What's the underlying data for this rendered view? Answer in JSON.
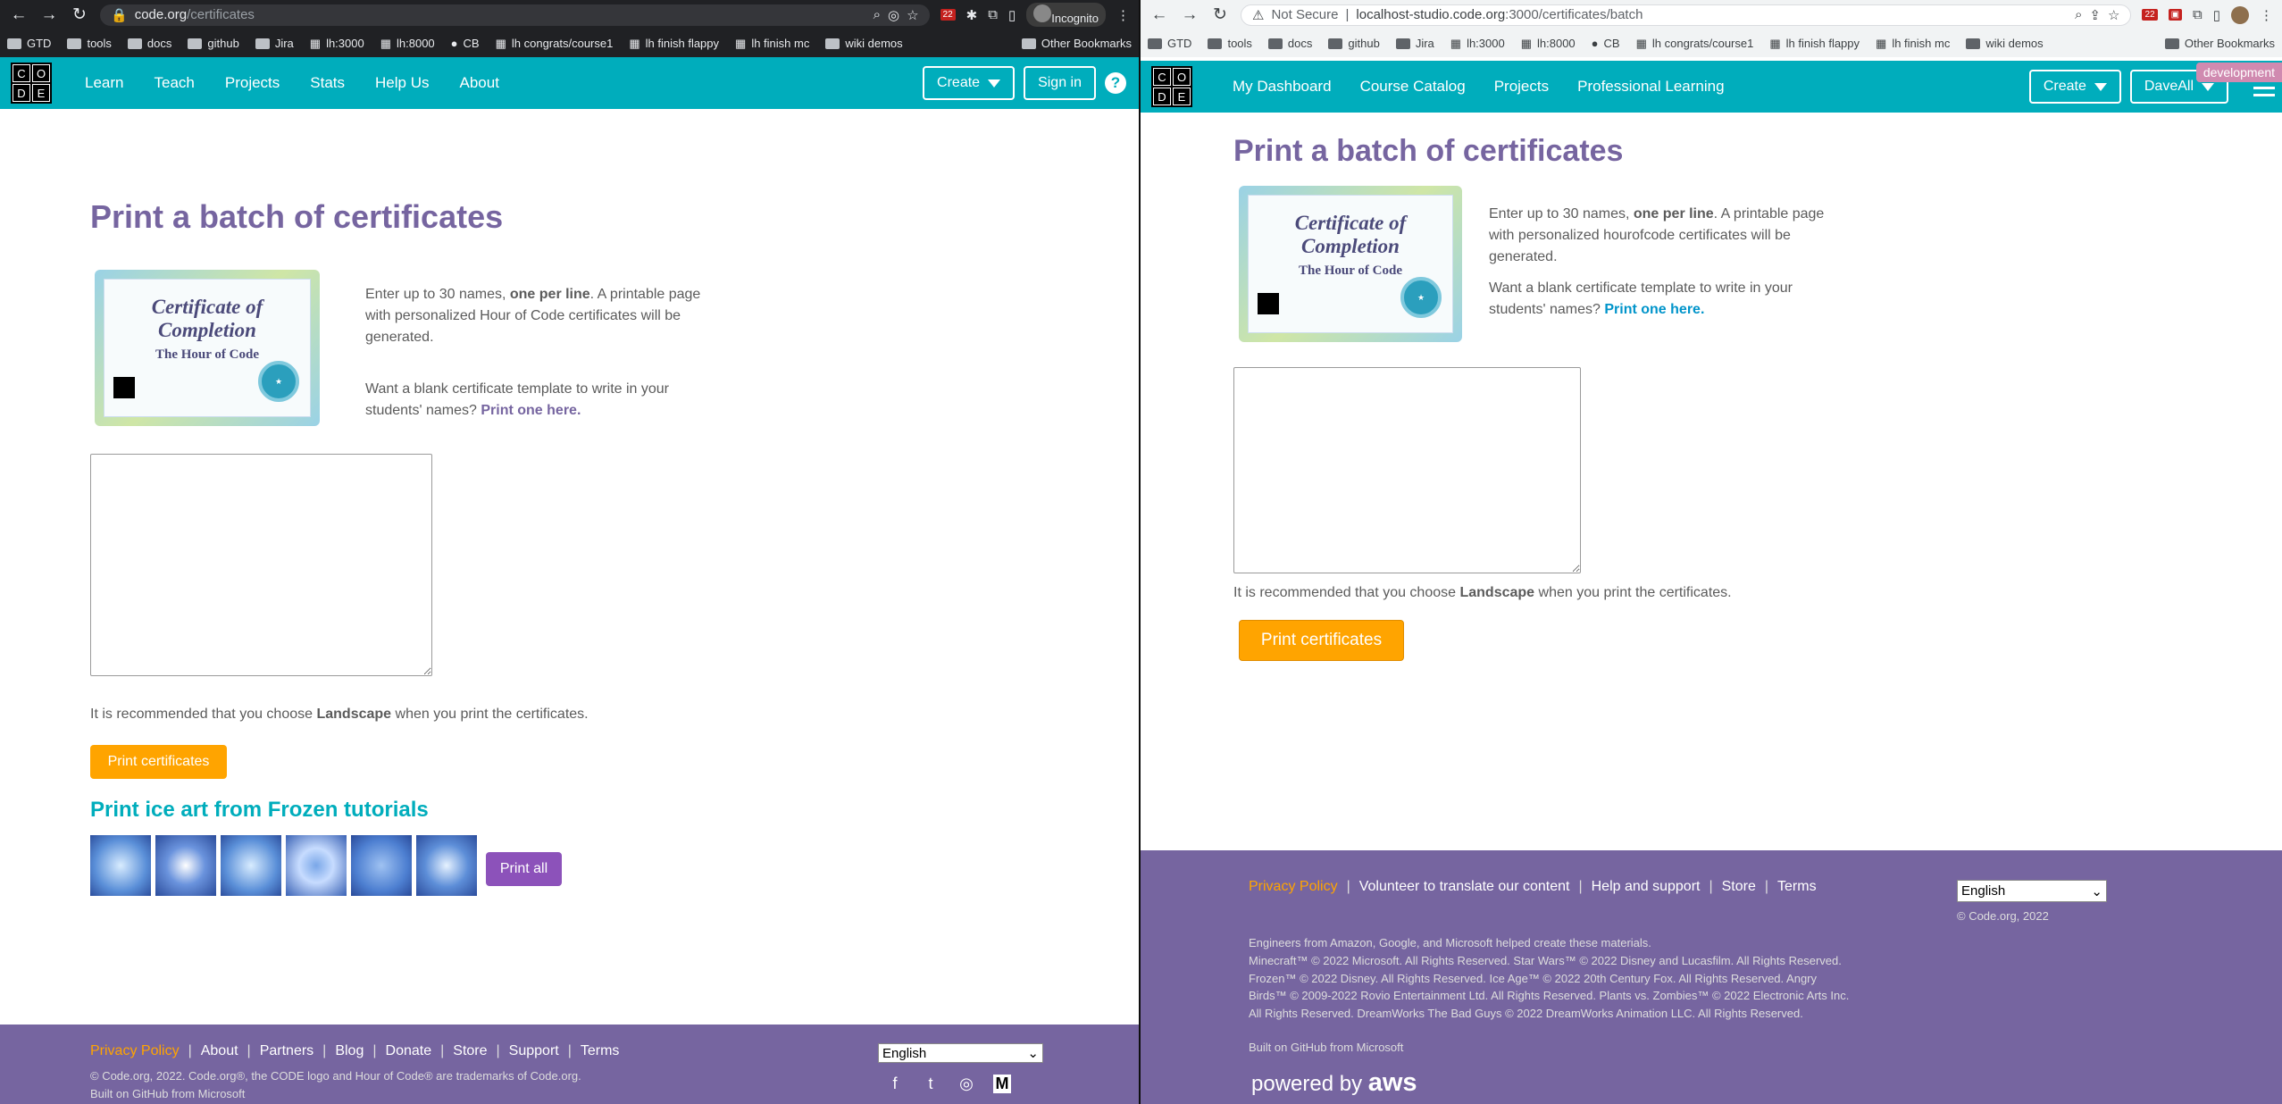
{
  "left": {
    "tab": {
      "url_host": "code.org",
      "url_path": "/certificates",
      "incognito": "Incognito"
    },
    "bookmarks": [
      "GTD",
      "tools",
      "docs",
      "github",
      "Jira",
      "lh:3000",
      "lh:8000",
      "CB",
      "lh congrats/course1",
      "lh finish flappy",
      "lh finish mc",
      "wiki demos"
    ],
    "other_bookmarks": "Other Bookmarks",
    "nav": [
      "Learn",
      "Teach",
      "Projects",
      "Stats",
      "Help Us",
      "About"
    ],
    "create_label": "Create",
    "signin_label": "Sign in",
    "help_label": "?",
    "title": "Print a batch of certificates",
    "cert_title": "Certificate of Completion",
    "cert_sub": "The Hour of Code",
    "intro_pre": "Enter up to 30 names, ",
    "intro_bold": "one per line",
    "intro_post": ". A printable page with personalized Hour of Code certificates will be generated.",
    "blank_pre": "Want a blank certificate template to write in your students' names? ",
    "blank_link": "Print one here.",
    "rec_pre": "It is recommended that you choose ",
    "rec_bold": "Landscape",
    "rec_post": " when you print the certificates.",
    "print_button": "Print certificates",
    "ice_title": "Print ice art from Frozen tutorials",
    "print_all": "Print all",
    "footer_links": [
      "Privacy Policy",
      "About",
      "Partners",
      "Blog",
      "Donate",
      "Store",
      "Support",
      "Terms"
    ],
    "language": "English",
    "copyright": "© Code.org, 2022. Code.org®, the CODE logo and Hour of Code® are trademarks of Code.org.",
    "built": "Built on GitHub from Microsoft"
  },
  "right": {
    "tab": {
      "not_secure": "Not Secure",
      "url_host": "localhost-studio.code.org",
      "url_path": ":3000/certificates/batch"
    },
    "bookmarks": [
      "GTD",
      "tools",
      "docs",
      "github",
      "Jira",
      "lh:3000",
      "lh:8000",
      "CB",
      "lh congrats/course1",
      "lh finish flappy",
      "lh finish mc",
      "wiki demos"
    ],
    "other_bookmarks": "Other Bookmarks",
    "dev_tag": "development",
    "nav": [
      "My Dashboard",
      "Course Catalog",
      "Projects",
      "Professional Learning"
    ],
    "create_label": "Create",
    "user_label": "DaveAll",
    "title": "Print a batch of certificates",
    "cert_title": "Certificate of Completion",
    "cert_sub": "The Hour of Code",
    "intro_pre": "Enter up to 30 names, ",
    "intro_bold": "one per line",
    "intro_post": ". A printable page with personalized hourofcode certificates will be generated.",
    "blank_pre": "Want a blank certificate template to write in your students' names? ",
    "blank_link": "Print one here.",
    "rec_pre": "It is recommended that you choose ",
    "rec_bold": "Landscape",
    "rec_post": " when you print the certificates.",
    "print_button": "Print certificates",
    "footer_links": [
      "Privacy Policy",
      "Volunteer to translate our content",
      "Help and support",
      "Store",
      "Terms"
    ],
    "language": "English",
    "copyright": "© Code.org, 2022",
    "credits": "Engineers from Amazon, Google, and Microsoft helped create these materials.",
    "legal": "Minecraft™ © 2022 Microsoft. All Rights Reserved. Star Wars™ © 2022 Disney and Lucasfilm. All Rights Reserved. Frozen™ © 2022 Disney. All Rights Reserved. Ice Age™ © 2022 20th Century Fox. All Rights Reserved. Angry Birds™ © 2009-2022 Rovio Entertainment Ltd. All Rights Reserved. Plants vs. Zombies™ © 2022 Electronic Arts Inc. All Rights Reserved. DreamWorks The Bad Guys © 2022 DreamWorks Animation LLC. All Rights Reserved.",
    "built": "Built on GitHub from Microsoft",
    "powered_by": "powered by",
    "aws": "aws"
  },
  "colors": {
    "teal": "#00adbc",
    "purple": "#7665a0",
    "orange": "#ffa400",
    "link_left": "#7665a0",
    "link_right": "#0094ca",
    "print_all": "#8c52ba"
  }
}
